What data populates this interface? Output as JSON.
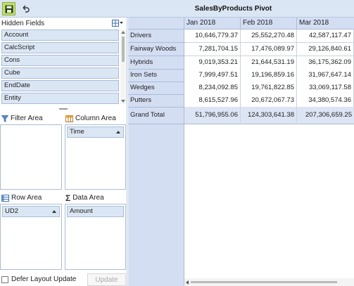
{
  "toolbar": {
    "title": "SalesByProducts Pivot",
    "save_icon": "save-icon",
    "undo_icon": "undo-icon"
  },
  "field_list": {
    "header_label": "Hidden Fields",
    "fields": [
      "Account",
      "CalcScript",
      "Cons",
      "Cube",
      "EndDate",
      "Entity"
    ]
  },
  "areas": {
    "filter": {
      "label": "Filter Area",
      "fields": []
    },
    "column": {
      "label": "Column Area",
      "fields": [
        "Time"
      ]
    },
    "row": {
      "label": "Row Area",
      "fields": [
        "UD2"
      ]
    },
    "data": {
      "label": "Data Area",
      "fields": [
        "Amount"
      ]
    }
  },
  "footer": {
    "defer_label": "Defer Layout Update",
    "defer_checked": false,
    "update_label": "Update"
  },
  "pivot": {
    "columns": [
      "Jan 2018",
      "Feb 2018",
      "Mar 2018"
    ],
    "rows": [
      {
        "label": "Drivers",
        "values": [
          "10,646,779.37",
          "25,552,270.48",
          "42,587,117.47"
        ]
      },
      {
        "label": "Fairway Woods",
        "values": [
          "7,281,704.15",
          "17,476,089.97",
          "29,126,840.61"
        ]
      },
      {
        "label": "Hybrids",
        "values": [
          "9,019,353.21",
          "21,644,531.19",
          "36,175,362.09"
        ]
      },
      {
        "label": "Iron Sets",
        "values": [
          "7,999,497.51",
          "19,196,859.16",
          "31,967,647.14"
        ]
      },
      {
        "label": "Wedges",
        "values": [
          "8,234,092.85",
          "19,761,822.85",
          "33,069,117.58"
        ]
      },
      {
        "label": "Putters",
        "values": [
          "8,615,527.96",
          "20,672,067.73",
          "34,380,574.36"
        ]
      }
    ],
    "grand_total": {
      "label": "Grand Total",
      "values": [
        "51,796,955.06",
        "124,303,641.38",
        "207,306,659.25"
      ]
    }
  },
  "colors": {
    "accent": "#c4de6a",
    "header_bg": "#d4def3",
    "field_bg": "#dbe6f4"
  }
}
